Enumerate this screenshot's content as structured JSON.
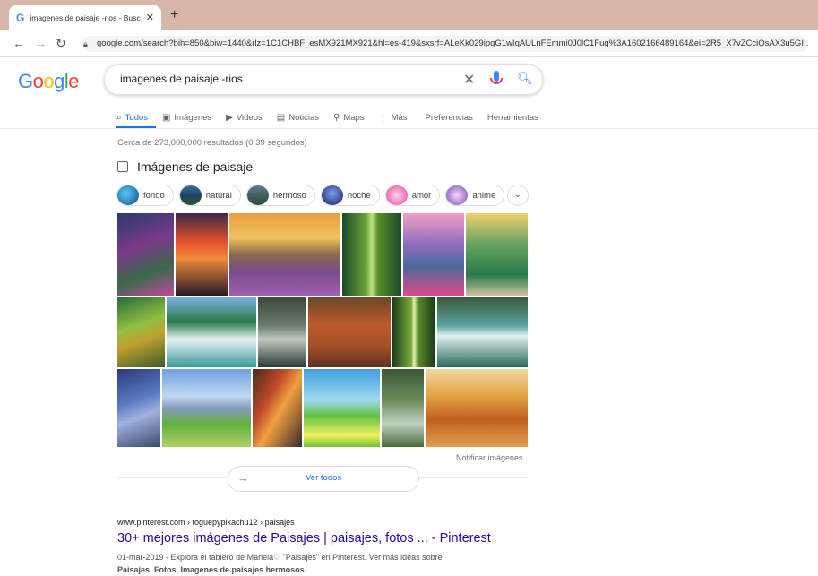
{
  "browser": {
    "tab_title": "imagenes de paisaje -rios - Busc",
    "tab_favicon": "G",
    "url": "google.com/search?bih=850&biw=1440&rlz=1C1CHBF_esMX921MX921&hl=es-419&sxsrf=ALeKk029ipqG1wIqAULnFEmmi0J0lC1Fug%3A1602166489164&ei=2R5_X7vZCciQsAX3u5GI..."
  },
  "search": {
    "logo": "Google",
    "query": "imagenes de paisaje -rios"
  },
  "tabs": [
    {
      "label": "Todos",
      "icon": "search-icon"
    },
    {
      "label": "Imágenes",
      "icon": "image-icon"
    },
    {
      "label": "Videos",
      "icon": "video-icon"
    },
    {
      "label": "Noticias",
      "icon": "news-icon"
    },
    {
      "label": "Maps",
      "icon": "map-pin-icon"
    },
    {
      "label": "Más",
      "icon": "more-vert-icon"
    },
    {
      "label": "Preferencias",
      "icon": ""
    },
    {
      "label": "Herramientas",
      "icon": ""
    }
  ],
  "results_stats": "Cerca de 273,000,000 resultados (0.39 segundos)",
  "images_block": {
    "heading": "Imágenes de paisaje",
    "chips": [
      "fondo",
      "natural",
      "hermoso",
      "noche",
      "amor",
      "anime"
    ],
    "notify": "Notificar imágenes",
    "view_all": "Ver todos"
  },
  "result": {
    "cite": "www.pinterest.com › toguepypikachu12 › paisajes",
    "title": "30+ mejores imágenes de Paisajes | paisajes, fotos ... - Pinterest",
    "snippet_line1": "01-mar-2019 - Explora el tablero de Mariela♡ \"Paisajes\" en Pinterest. Ver más ideas sobre",
    "snippet_line2": "Paisajes, Fotos, Imagenes de paisajes hermosos."
  },
  "colors": {
    "tabstrip": "#d7b7a9",
    "link_blue": "#1a0dab",
    "accent_blue": "#1a73e8"
  }
}
